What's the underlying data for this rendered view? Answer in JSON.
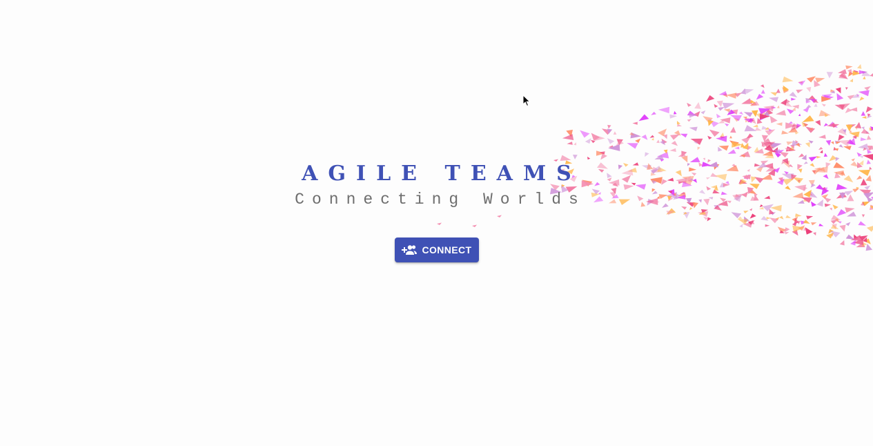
{
  "hero": {
    "title": "AGILE TEAMS",
    "subtitle": "Connecting Worlds"
  },
  "actions": {
    "connect_label": "CONNECT",
    "connect_icon": "group-add-icon"
  },
  "colors": {
    "background": "#fdfdfd",
    "primary": "#3f51b5",
    "subtitle": "#6e6e6e",
    "button_text": "#ffffff",
    "particle_palette": [
      "#f06292",
      "#ec407a",
      "#ff8a65",
      "#ce93d8",
      "#e040fb",
      "#ffb74d",
      "#f48fb1"
    ]
  },
  "decoration": {
    "particle_style": "triangle-flock"
  }
}
